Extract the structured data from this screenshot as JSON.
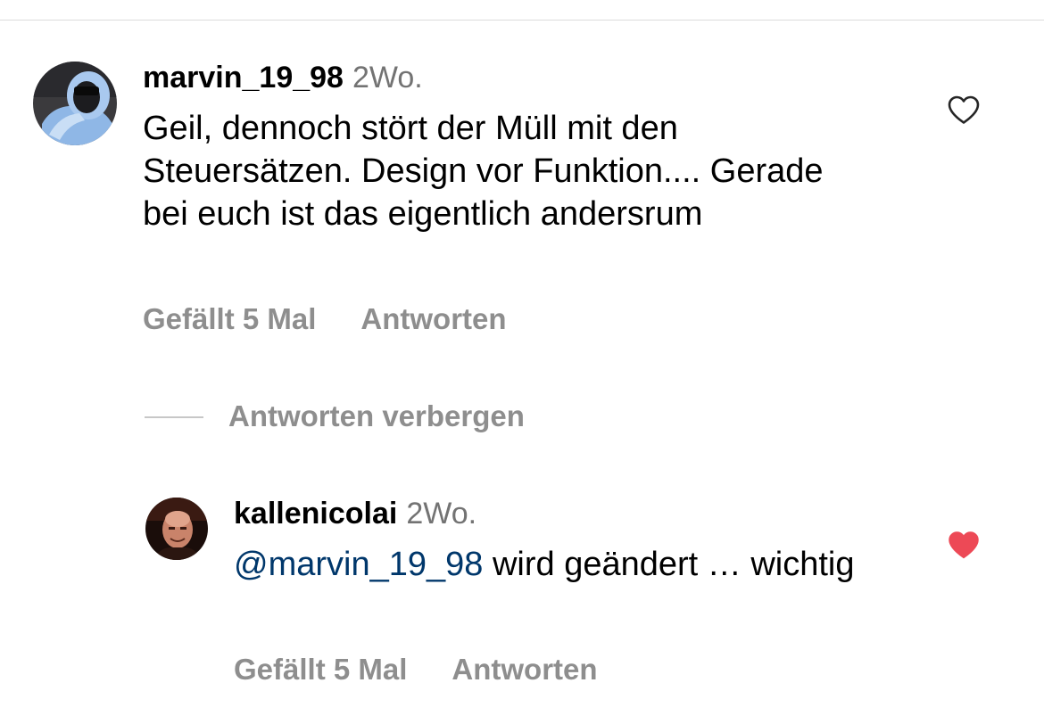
{
  "comment": {
    "username": "marvin_19_98",
    "time": "2Wo.",
    "text": "Geil, dennoch stört der Müll mit den Steuersätzen.  Design vor Funktion.... Gerade bei euch ist das eigentlich andersrum",
    "likes_label": "Gefällt 5 Mal",
    "reply_label": "Antworten",
    "like_icon": "heart-outline-icon",
    "liked": false
  },
  "hide_replies_label": "Antworten verbergen",
  "reply": {
    "username": "kallenicolai",
    "time": "2Wo.",
    "mention": "@marvin_19_98",
    "text": " wird geändert … wichtig",
    "likes_label": "Gefällt 5 Mal",
    "reply_label": "Antworten",
    "like_icon": "heart-filled-icon",
    "liked": true
  },
  "colors": {
    "liked_heart": "#ed4956",
    "mention": "#00376b",
    "secondary_text": "#8e8e8e"
  }
}
